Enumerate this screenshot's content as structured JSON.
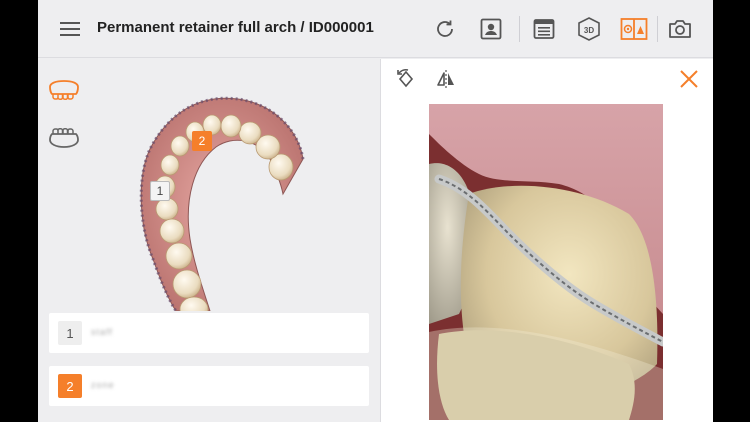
{
  "header": {
    "title": "Permanent retainer full arch / ID000001",
    "icons": [
      "menu-icon",
      "refresh-icon",
      "patient-icon",
      "report-icon",
      "3d-view-icon",
      "compare-view-icon",
      "camera-icon"
    ],
    "accent_color": "#f57f2a"
  },
  "left_panel": {
    "jaw_buttons": [
      {
        "name": "upper-jaw",
        "active": true
      },
      {
        "name": "lower-jaw",
        "active": false
      }
    ],
    "markers": [
      {
        "label": "1"
      },
      {
        "label": "2",
        "active": true
      }
    ],
    "list": [
      {
        "number": "1",
        "label": "staff"
      },
      {
        "number": "2",
        "label": "zone"
      }
    ]
  },
  "right_panel": {
    "icons": [
      "rotate-icon",
      "flip-horizontal-icon",
      "close-icon"
    ]
  }
}
